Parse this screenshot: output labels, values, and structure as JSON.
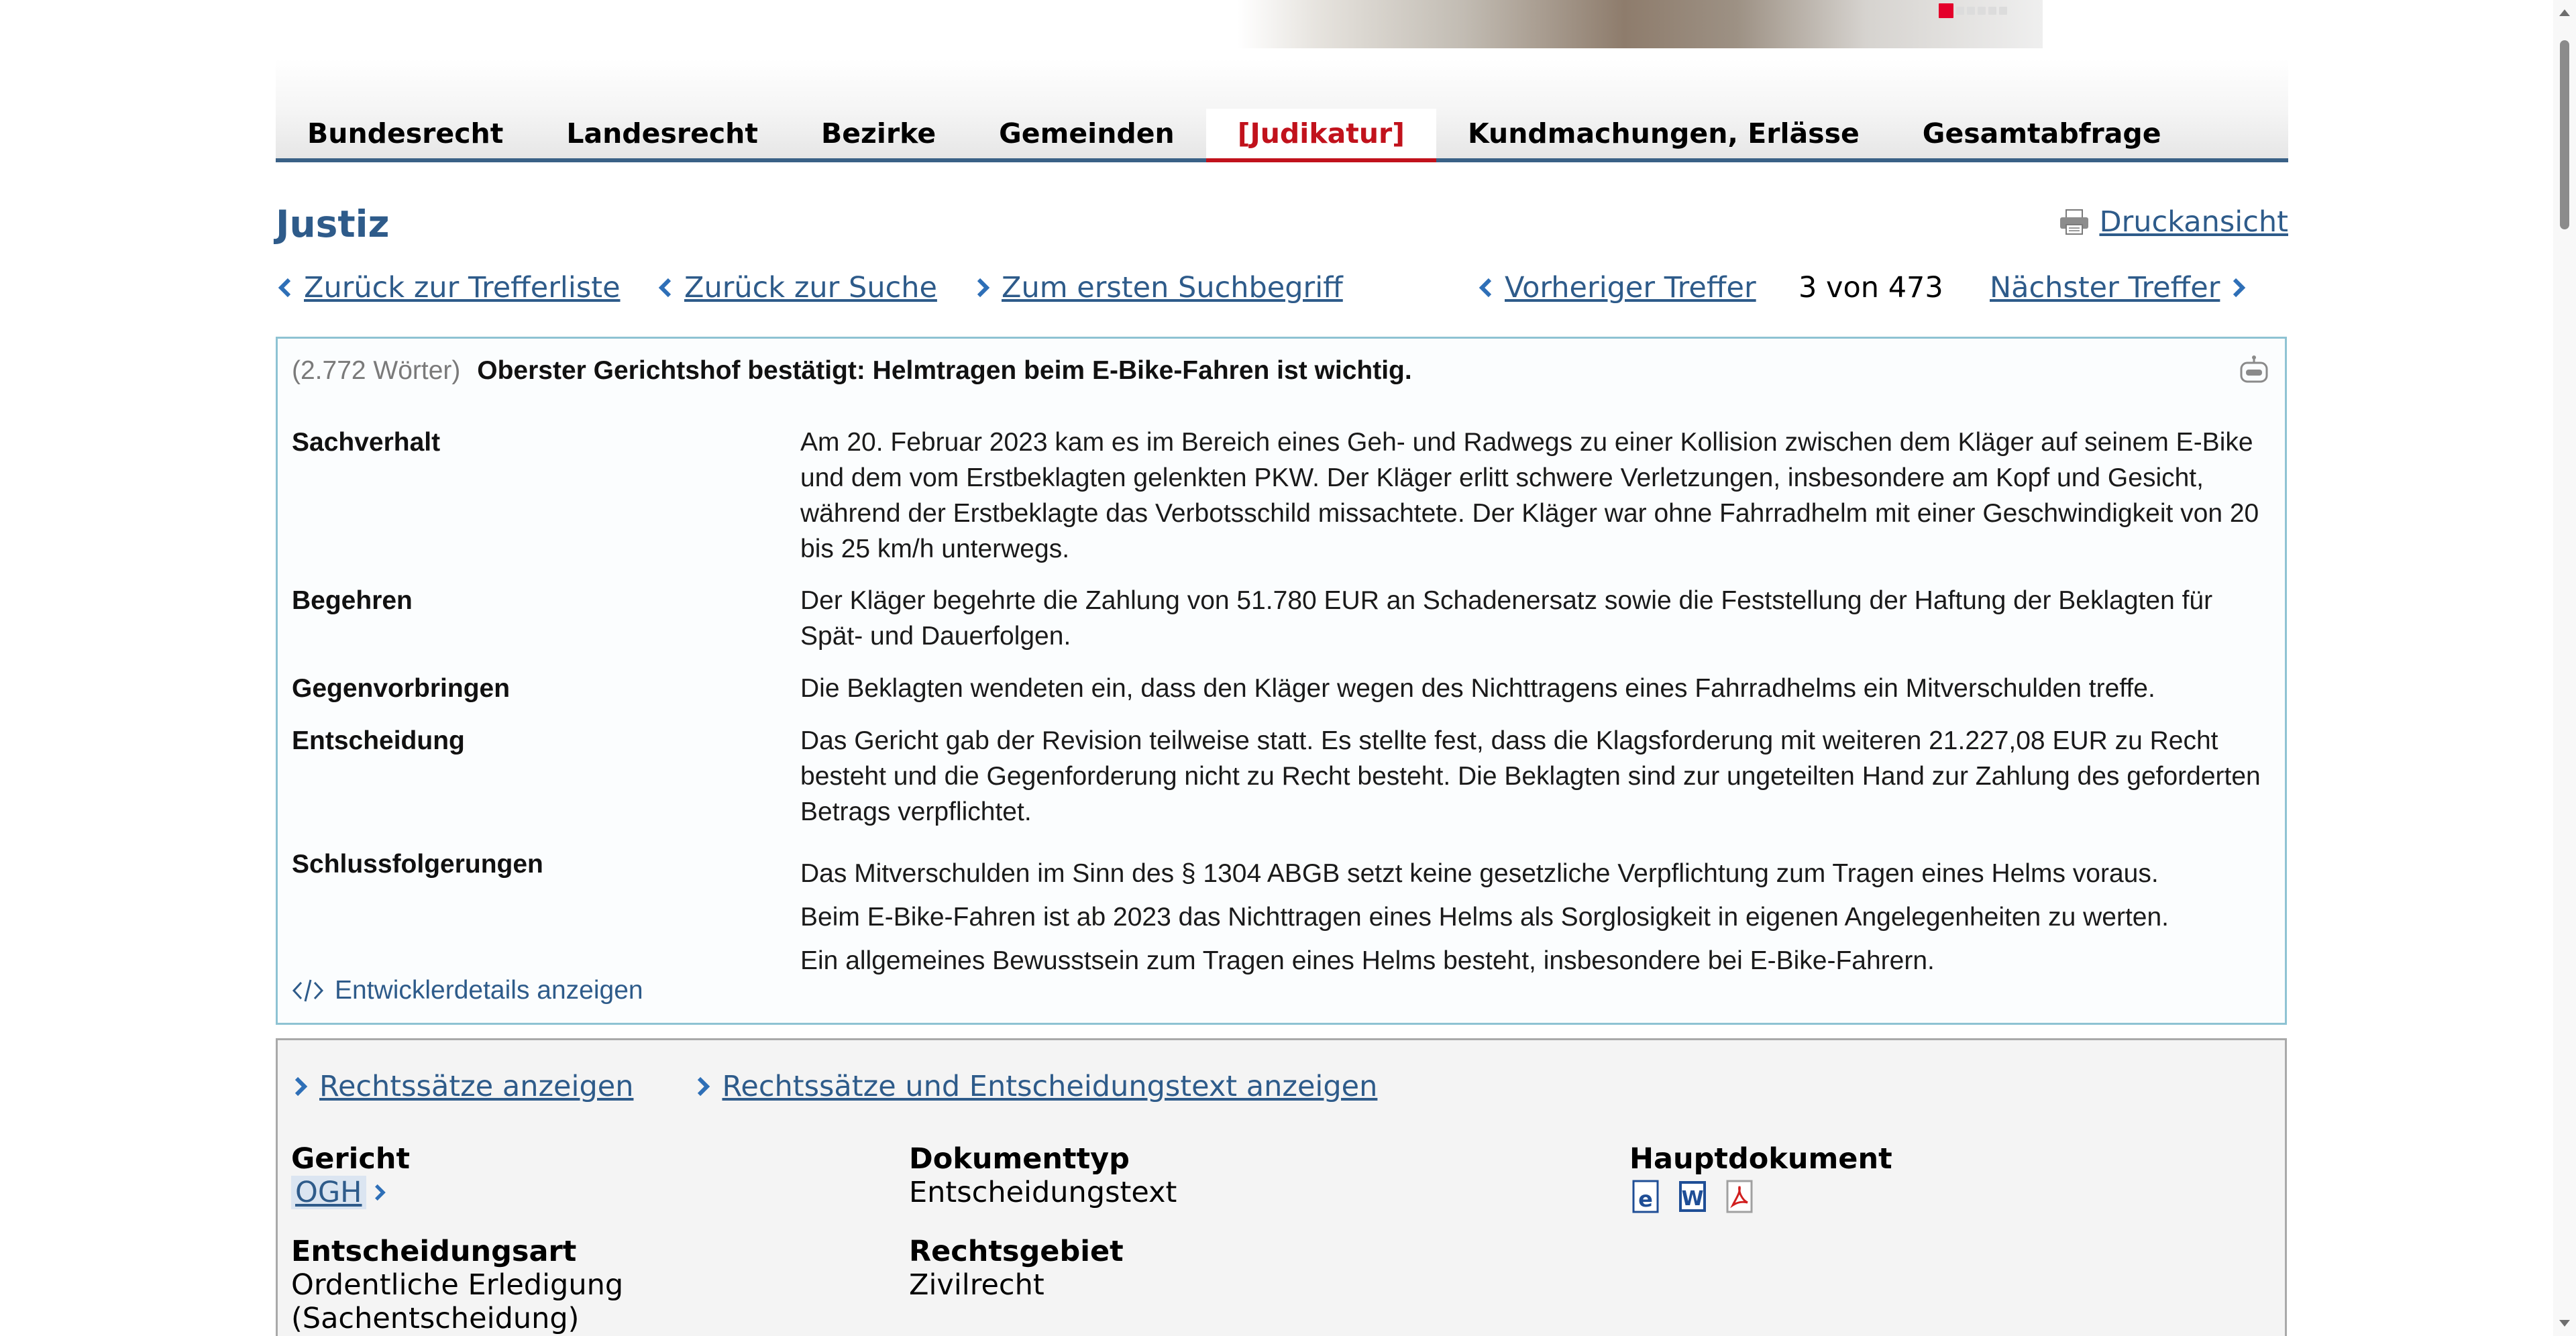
{
  "nav": {
    "items": [
      {
        "label": "Bundesrecht"
      },
      {
        "label": "Landesrecht"
      },
      {
        "label": "Bezirke"
      },
      {
        "label": "Gemeinden"
      },
      {
        "label": "[Judikatur]"
      },
      {
        "label": "Kundmachungen, Erlässe"
      },
      {
        "label": "Gesamtabfrage"
      }
    ],
    "active_index": 4
  },
  "page": {
    "title": "Justiz",
    "print_label": "Druckansicht"
  },
  "result_nav": {
    "back_to_results": "Zurück zur Trefferliste",
    "back_to_search": "Zurück zur Suche",
    "first_term": "Zum ersten Suchbegriff",
    "previous": "Vorheriger Treffer",
    "counter": "3 von 473",
    "next": "Nächster Treffer"
  },
  "summary": {
    "word_count": "(2.772 Wörter)",
    "headline": "Oberster Gerichtshof bestätigt: Helmtragen beim E-Bike-Fahren ist wichtig.",
    "rows": [
      {
        "label": "Sachverhalt",
        "text": "Am 20. Februar 2023 kam es im Bereich eines Geh- und Radwegs zu einer Kollision zwischen dem Kläger auf seinem E-Bike und dem vom Erstbeklagten gelenkten PKW. Der Kläger erlitt schwere Verletzungen, insbesondere am Kopf und Gesicht, während der Erstbeklagte das Verbotsschild missachtete. Der Kläger war ohne Fahrradhelm mit einer Geschwindigkeit von 20 bis 25 km/h unterwegs."
      },
      {
        "label": "Begehren",
        "text": "Der Kläger begehrte die Zahlung von 51.780 EUR an Schadenersatz sowie die Feststellung der Haftung der Beklagten für Spät- und Dauerfolgen."
      },
      {
        "label": "Gegenvorbringen",
        "text": "Die Beklagten wendeten ein, dass den Kläger wegen des Nichttragens eines Fahrradhelms ein Mitverschulden treffe."
      },
      {
        "label": "Entscheidung",
        "text": "Das Gericht gab der Revision teilweise statt. Es stellte fest, dass die Klagsforderung mit weiteren 21.227,08 EUR zu Recht besteht und die Gegenforderung nicht zu Recht besteht. Die Beklagten sind zur ungeteilten Hand zur Zahlung des geforderten Betrags verpflichtet."
      }
    ],
    "conclusions": {
      "label": "Schlussfolgerungen",
      "items": [
        "Das Mitverschulden im Sinn des § 1304 ABGB setzt keine gesetzliche Verpflichtung zum Tragen eines Helms voraus.",
        "Beim E-Bike-Fahren ist ab 2023 das Nichttragen eines Helms als Sorglosigkeit in eigenen Angelegenheiten zu werten.",
        "Ein allgemeines Bewusstsein zum Tragen eines Helms besteht, insbesondere bei E-Bike-Fahrern."
      ]
    },
    "dev_details": "Entwicklerdetails anzeigen"
  },
  "meta": {
    "links": {
      "rechtssaetze": "Rechtssätze anzeigen",
      "rechtssaetze_text": "Rechtssätze und Entscheidungstext anzeigen"
    },
    "gericht": {
      "label": "Gericht",
      "value": "OGH"
    },
    "dokumenttyp": {
      "label": "Dokumenttyp",
      "value": "Entscheidungstext"
    },
    "hauptdokument": {
      "label": "Hauptdokument"
    },
    "entscheidungsart": {
      "label": "Entscheidungsart",
      "value_line1": "Ordentliche Erledigung",
      "value_line2": "(Sachentscheidung)"
    },
    "rechtsgebiet": {
      "label": "Rechtsgebiet",
      "value": "Zivilrecht"
    }
  },
  "colors": {
    "accent": "#2e5b8a",
    "active_nav": "#c1121c",
    "summary_border": "#8ec3d3"
  },
  "icons": {
    "print": "printer-icon",
    "left": "chevron-left-icon",
    "right": "chevron-right-icon",
    "robot": "robot-icon",
    "code": "code-icon",
    "html_doc": "html-document-icon",
    "word_doc": "word-document-icon",
    "pdf_doc": "pdf-document-icon"
  }
}
